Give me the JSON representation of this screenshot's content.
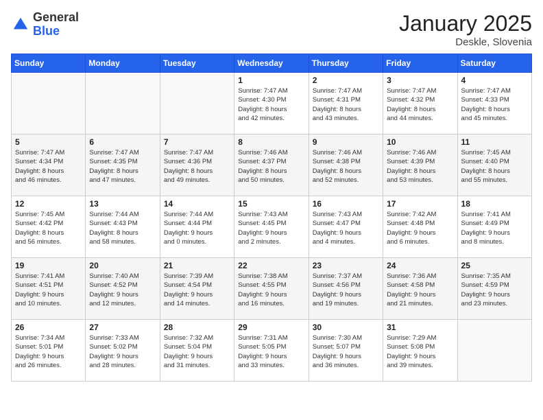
{
  "header": {
    "logo_general": "General",
    "logo_blue": "Blue",
    "month_title": "January 2025",
    "location": "Deskle, Slovenia"
  },
  "weekdays": [
    "Sunday",
    "Monday",
    "Tuesday",
    "Wednesday",
    "Thursday",
    "Friday",
    "Saturday"
  ],
  "weeks": [
    [
      {
        "day": "",
        "info": ""
      },
      {
        "day": "",
        "info": ""
      },
      {
        "day": "",
        "info": ""
      },
      {
        "day": "1",
        "info": "Sunrise: 7:47 AM\nSunset: 4:30 PM\nDaylight: 8 hours\nand 42 minutes."
      },
      {
        "day": "2",
        "info": "Sunrise: 7:47 AM\nSunset: 4:31 PM\nDaylight: 8 hours\nand 43 minutes."
      },
      {
        "day": "3",
        "info": "Sunrise: 7:47 AM\nSunset: 4:32 PM\nDaylight: 8 hours\nand 44 minutes."
      },
      {
        "day": "4",
        "info": "Sunrise: 7:47 AM\nSunset: 4:33 PM\nDaylight: 8 hours\nand 45 minutes."
      }
    ],
    [
      {
        "day": "5",
        "info": "Sunrise: 7:47 AM\nSunset: 4:34 PM\nDaylight: 8 hours\nand 46 minutes."
      },
      {
        "day": "6",
        "info": "Sunrise: 7:47 AM\nSunset: 4:35 PM\nDaylight: 8 hours\nand 47 minutes."
      },
      {
        "day": "7",
        "info": "Sunrise: 7:47 AM\nSunset: 4:36 PM\nDaylight: 8 hours\nand 49 minutes."
      },
      {
        "day": "8",
        "info": "Sunrise: 7:46 AM\nSunset: 4:37 PM\nDaylight: 8 hours\nand 50 minutes."
      },
      {
        "day": "9",
        "info": "Sunrise: 7:46 AM\nSunset: 4:38 PM\nDaylight: 8 hours\nand 52 minutes."
      },
      {
        "day": "10",
        "info": "Sunrise: 7:46 AM\nSunset: 4:39 PM\nDaylight: 8 hours\nand 53 minutes."
      },
      {
        "day": "11",
        "info": "Sunrise: 7:45 AM\nSunset: 4:40 PM\nDaylight: 8 hours\nand 55 minutes."
      }
    ],
    [
      {
        "day": "12",
        "info": "Sunrise: 7:45 AM\nSunset: 4:42 PM\nDaylight: 8 hours\nand 56 minutes."
      },
      {
        "day": "13",
        "info": "Sunrise: 7:44 AM\nSunset: 4:43 PM\nDaylight: 8 hours\nand 58 minutes."
      },
      {
        "day": "14",
        "info": "Sunrise: 7:44 AM\nSunset: 4:44 PM\nDaylight: 9 hours\nand 0 minutes."
      },
      {
        "day": "15",
        "info": "Sunrise: 7:43 AM\nSunset: 4:45 PM\nDaylight: 9 hours\nand 2 minutes."
      },
      {
        "day": "16",
        "info": "Sunrise: 7:43 AM\nSunset: 4:47 PM\nDaylight: 9 hours\nand 4 minutes."
      },
      {
        "day": "17",
        "info": "Sunrise: 7:42 AM\nSunset: 4:48 PM\nDaylight: 9 hours\nand 6 minutes."
      },
      {
        "day": "18",
        "info": "Sunrise: 7:41 AM\nSunset: 4:49 PM\nDaylight: 9 hours\nand 8 minutes."
      }
    ],
    [
      {
        "day": "19",
        "info": "Sunrise: 7:41 AM\nSunset: 4:51 PM\nDaylight: 9 hours\nand 10 minutes."
      },
      {
        "day": "20",
        "info": "Sunrise: 7:40 AM\nSunset: 4:52 PM\nDaylight: 9 hours\nand 12 minutes."
      },
      {
        "day": "21",
        "info": "Sunrise: 7:39 AM\nSunset: 4:54 PM\nDaylight: 9 hours\nand 14 minutes."
      },
      {
        "day": "22",
        "info": "Sunrise: 7:38 AM\nSunset: 4:55 PM\nDaylight: 9 hours\nand 16 minutes."
      },
      {
        "day": "23",
        "info": "Sunrise: 7:37 AM\nSunset: 4:56 PM\nDaylight: 9 hours\nand 19 minutes."
      },
      {
        "day": "24",
        "info": "Sunrise: 7:36 AM\nSunset: 4:58 PM\nDaylight: 9 hours\nand 21 minutes."
      },
      {
        "day": "25",
        "info": "Sunrise: 7:35 AM\nSunset: 4:59 PM\nDaylight: 9 hours\nand 23 minutes."
      }
    ],
    [
      {
        "day": "26",
        "info": "Sunrise: 7:34 AM\nSunset: 5:01 PM\nDaylight: 9 hours\nand 26 minutes."
      },
      {
        "day": "27",
        "info": "Sunrise: 7:33 AM\nSunset: 5:02 PM\nDaylight: 9 hours\nand 28 minutes."
      },
      {
        "day": "28",
        "info": "Sunrise: 7:32 AM\nSunset: 5:04 PM\nDaylight: 9 hours\nand 31 minutes."
      },
      {
        "day": "29",
        "info": "Sunrise: 7:31 AM\nSunset: 5:05 PM\nDaylight: 9 hours\nand 33 minutes."
      },
      {
        "day": "30",
        "info": "Sunrise: 7:30 AM\nSunset: 5:07 PM\nDaylight: 9 hours\nand 36 minutes."
      },
      {
        "day": "31",
        "info": "Sunrise: 7:29 AM\nSunset: 5:08 PM\nDaylight: 9 hours\nand 39 minutes."
      },
      {
        "day": "",
        "info": ""
      }
    ]
  ]
}
